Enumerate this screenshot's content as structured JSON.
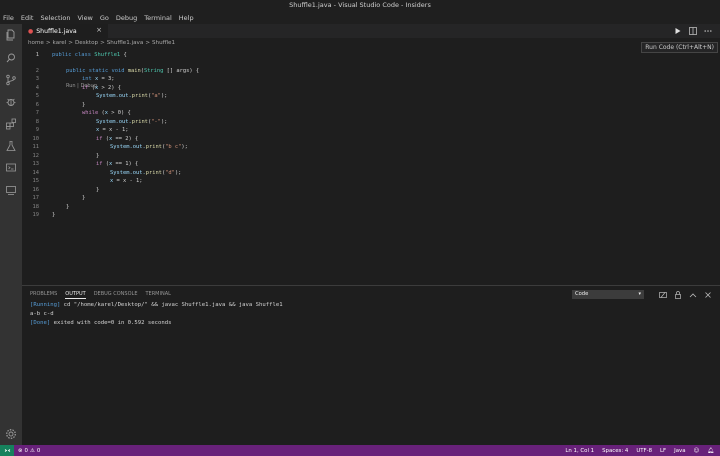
{
  "window": {
    "title": "Shuffle1.java - Visual Studio Code - Insiders"
  },
  "menu": [
    "File",
    "Edit",
    "Selection",
    "View",
    "Go",
    "Debug",
    "Terminal",
    "Help"
  ],
  "tab": {
    "label": "Shuffle1.java",
    "close": "×"
  },
  "breadcrumb": [
    "home",
    ">",
    "karel",
    ">",
    "Desktop",
    ">",
    "Shuffle1.java",
    ">",
    "Shuffle1"
  ],
  "tooltip": "Run Code (Ctrl+Alt+N)",
  "codelens": "Run | Debug",
  "code": {
    "lines": [
      {
        "n": "1"
      },
      {
        "n": "2"
      },
      {
        "n": "3"
      },
      {
        "n": "4"
      },
      {
        "n": "5"
      },
      {
        "n": "6"
      },
      {
        "n": "7"
      },
      {
        "n": "8"
      },
      {
        "n": "9"
      },
      {
        "n": "10"
      },
      {
        "n": "11"
      },
      {
        "n": "12"
      },
      {
        "n": "13"
      },
      {
        "n": "14"
      },
      {
        "n": "15"
      },
      {
        "n": "16"
      },
      {
        "n": "17"
      },
      {
        "n": "18"
      },
      {
        "n": "19"
      }
    ],
    "t": {
      "public": "public",
      "class": "class",
      "Shuffle1": "Shuffle1",
      "brace_open": "{",
      "static": "static",
      "void": "void",
      "main": "main",
      "String": "String",
      "args_tail": " [] args) {",
      "int": "int",
      "x": "x",
      "eq3": " = 3;",
      "if": "if",
      "while": "while",
      "System": "System.out.",
      "print": "print",
      "s_a": "\"a\"",
      "s_dash": "\"-\"",
      "s_bc": "\"b c\"",
      "s_d": "\"d\"",
      "gt2": " > 2) {",
      "gt0": " > 0) {",
      "eq2": " == 2) {",
      "eq1": " == 1) {",
      "minus1": " = x - 1;",
      "close_paren": ");",
      "close": "}"
    }
  },
  "panel": {
    "tabs": [
      "PROBLEMS",
      "OUTPUT",
      "DEBUG CONSOLE",
      "TERMINAL"
    ],
    "active_tab": "OUTPUT",
    "channel": "Code",
    "output": {
      "l1_tag": "[Running]",
      "l1_text": " cd \"/home/karel/Desktop/\" && javac Shuffle1.java && java Shuffle1",
      "l2_text": "a-b c-d",
      "l3_tag": "[Done]",
      "l3_text": " exited with code=0 in 0.592 seconds"
    }
  },
  "status": {
    "errors": "0",
    "warnings": "0",
    "position": "Ln 1, Col 1",
    "spaces": "Spaces: 4",
    "encoding": "UTF-8",
    "eol": "LF",
    "language": "Java"
  },
  "colors": {
    "statusbar": "#68217a",
    "remote": "#16825d",
    "editor_bg": "#1e1e1e",
    "activity_bg": "#333333"
  }
}
